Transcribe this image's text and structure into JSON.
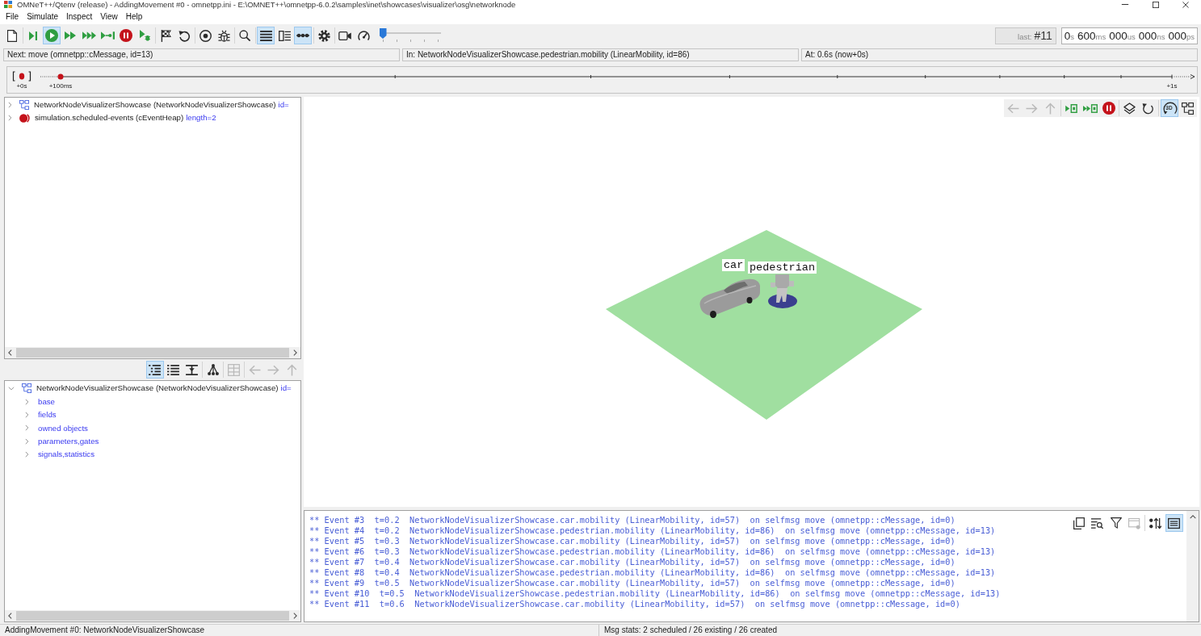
{
  "window": {
    "title": "OMNeT++/Qtenv (release) - AddingMovement #0 - omnetpp.ini - E:\\OMNET++\\omnetpp-6.0.2\\samples\\inet\\showcases\\visualizer\\osg\\networknode"
  },
  "menu": [
    "File",
    "Simulate",
    "Inspect",
    "View",
    "Help"
  ],
  "toolbar": {
    "groups": [
      [
        {
          "on": false
        }
      ],
      [
        {
          "on": false
        },
        {
          "on": true
        },
        {
          "on": false
        },
        {
          "on": false
        },
        {
          "on": false
        },
        {
          "on": false
        },
        {
          "on": false
        }
      ],
      [
        {
          "on": false
        },
        {
          "on": false
        }
      ],
      [
        {
          "on": false
        },
        {
          "on": false
        }
      ],
      [
        {
          "on": false
        }
      ],
      [
        {
          "on": true
        },
        {
          "on": false
        },
        {
          "on": true
        }
      ],
      [
        {
          "on": false
        }
      ],
      [
        {
          "on": false
        },
        {
          "on": false
        }
      ]
    ],
    "speed_slider": {
      "level": 0
    }
  },
  "event_counter": {
    "label": "last:",
    "value": "#11"
  },
  "sim_time": [
    {
      "value": "0",
      "unit": "s"
    },
    {
      "value": "600",
      "unit": "ms"
    },
    {
      "value": "000",
      "unit": "us"
    },
    {
      "value": "000",
      "unit": "ns"
    },
    {
      "value": "000",
      "unit": "ps"
    }
  ],
  "status_fields": [
    "Next: move (omnetpp::cMessage, id=13)",
    "In: NetworkNodeVisualizerShowcase.pedestrian.mobility (LinearMobility, id=86)",
    "At: 0.6s (now+0s)"
  ],
  "timeline": {
    "start_label": "+0s",
    "end_label": "+1s",
    "events": [
      {
        "label": "+100ms"
      }
    ]
  },
  "object_tree": {
    "items": [
      {
        "label": "NetworkNodeVisualizerShowcase (NetworkNodeVisualizerShowcase)",
        "info": "id=",
        "expanded": false,
        "kind": "module"
      },
      {
        "label": "simulation.scheduled-events (cEventHeap)",
        "info": "length=2",
        "expanded": false,
        "kind": "event_queue"
      }
    ]
  },
  "inspector_toolbar": {
    "groups": [
      [
        {
          "on": true,
          "disabled": false
        },
        {
          "on": false,
          "disabled": false
        },
        {
          "on": false,
          "disabled": false
        }
      ],
      [
        {
          "on": false,
          "disabled": false
        }
      ],
      [
        {
          "on": false,
          "disabled": true
        }
      ],
      [
        {
          "on": false,
          "disabled": true
        },
        {
          "on": false,
          "disabled": true
        },
        {
          "on": false,
          "disabled": true
        }
      ]
    ]
  },
  "inspector_tree": {
    "items": [
      {
        "label": "NetworkNodeVisualizerShowcase (NetworkNodeVisualizerShowcase)",
        "info": "id=",
        "expanded": true,
        "kind": "module",
        "children": [
          {
            "label": "base",
            "expanded": false
          },
          {
            "label": "fields",
            "expanded": false
          },
          {
            "label": "owned objects",
            "expanded": false
          },
          {
            "label": "parameters,gates",
            "expanded": false
          },
          {
            "label": "signals,statistics",
            "expanded": false
          }
        ]
      }
    ]
  },
  "viewer": {
    "toolbar": {
      "groups": [
        [
          {
            "on": false,
            "disabled": true
          },
          {
            "on": false,
            "disabled": true
          },
          {
            "on": false,
            "disabled": true
          }
        ],
        [
          {
            "on": false,
            "disabled": false
          },
          {
            "on": false,
            "disabled": false
          },
          {
            "on": false,
            "disabled": false
          }
        ],
        [
          {
            "on": false,
            "disabled": false
          },
          {
            "on": false,
            "disabled": false
          }
        ],
        [
          {
            "on": true,
            "disabled": false,
            "label": "3D"
          },
          {
            "on": false,
            "disabled": false
          }
        ]
      ]
    },
    "nodes": [
      {
        "label": "car",
        "kind": "car"
      },
      {
        "label": "pedestrian",
        "kind": "pedestrian"
      }
    ]
  },
  "log": {
    "toolbar": {
      "groups": [
        [
          {
            "on": false,
            "disabled": false
          },
          {
            "on": false,
            "disabled": false
          },
          {
            "on": false,
            "disabled": false
          },
          {
            "on": false,
            "disabled": true
          }
        ],
        [
          {
            "on": false,
            "disabled": false
          },
          {
            "on": true,
            "disabled": false
          }
        ]
      ]
    },
    "lines": [
      "** Event #3  t=0.2  NetworkNodeVisualizerShowcase.car.mobility (LinearMobility, id=57)  on selfmsg move (omnetpp::cMessage, id=0)",
      "** Event #4  t=0.2  NetworkNodeVisualizerShowcase.pedestrian.mobility (LinearMobility, id=86)  on selfmsg move (omnetpp::cMessage, id=13)",
      "** Event #5  t=0.3  NetworkNodeVisualizerShowcase.car.mobility (LinearMobility, id=57)  on selfmsg move (omnetpp::cMessage, id=0)",
      "** Event #6  t=0.3  NetworkNodeVisualizerShowcase.pedestrian.mobility (LinearMobility, id=86)  on selfmsg move (omnetpp::cMessage, id=13)",
      "** Event #7  t=0.4  NetworkNodeVisualizerShowcase.car.mobility (LinearMobility, id=57)  on selfmsg move (omnetpp::cMessage, id=0)",
      "** Event #8  t=0.4  NetworkNodeVisualizerShowcase.pedestrian.mobility (LinearMobility, id=86)  on selfmsg move (omnetpp::cMessage, id=13)",
      "** Event #9  t=0.5  NetworkNodeVisualizerShowcase.car.mobility (LinearMobility, id=57)  on selfmsg move (omnetpp::cMessage, id=0)",
      "** Event #10  t=0.5  NetworkNodeVisualizerShowcase.pedestrian.mobility (LinearMobility, id=86)  on selfmsg move (omnetpp::cMessage, id=13)",
      "** Event #11  t=0.6  NetworkNodeVisualizerShowcase.car.mobility (LinearMobility, id=57)  on selfmsg move (omnetpp::cMessage, id=0)"
    ]
  },
  "status_bar": [
    "AddingMovement #0: NetworkNodeVisualizerShowcase",
    "Msg stats: 2 scheduled / 26 existing / 26 created"
  ]
}
